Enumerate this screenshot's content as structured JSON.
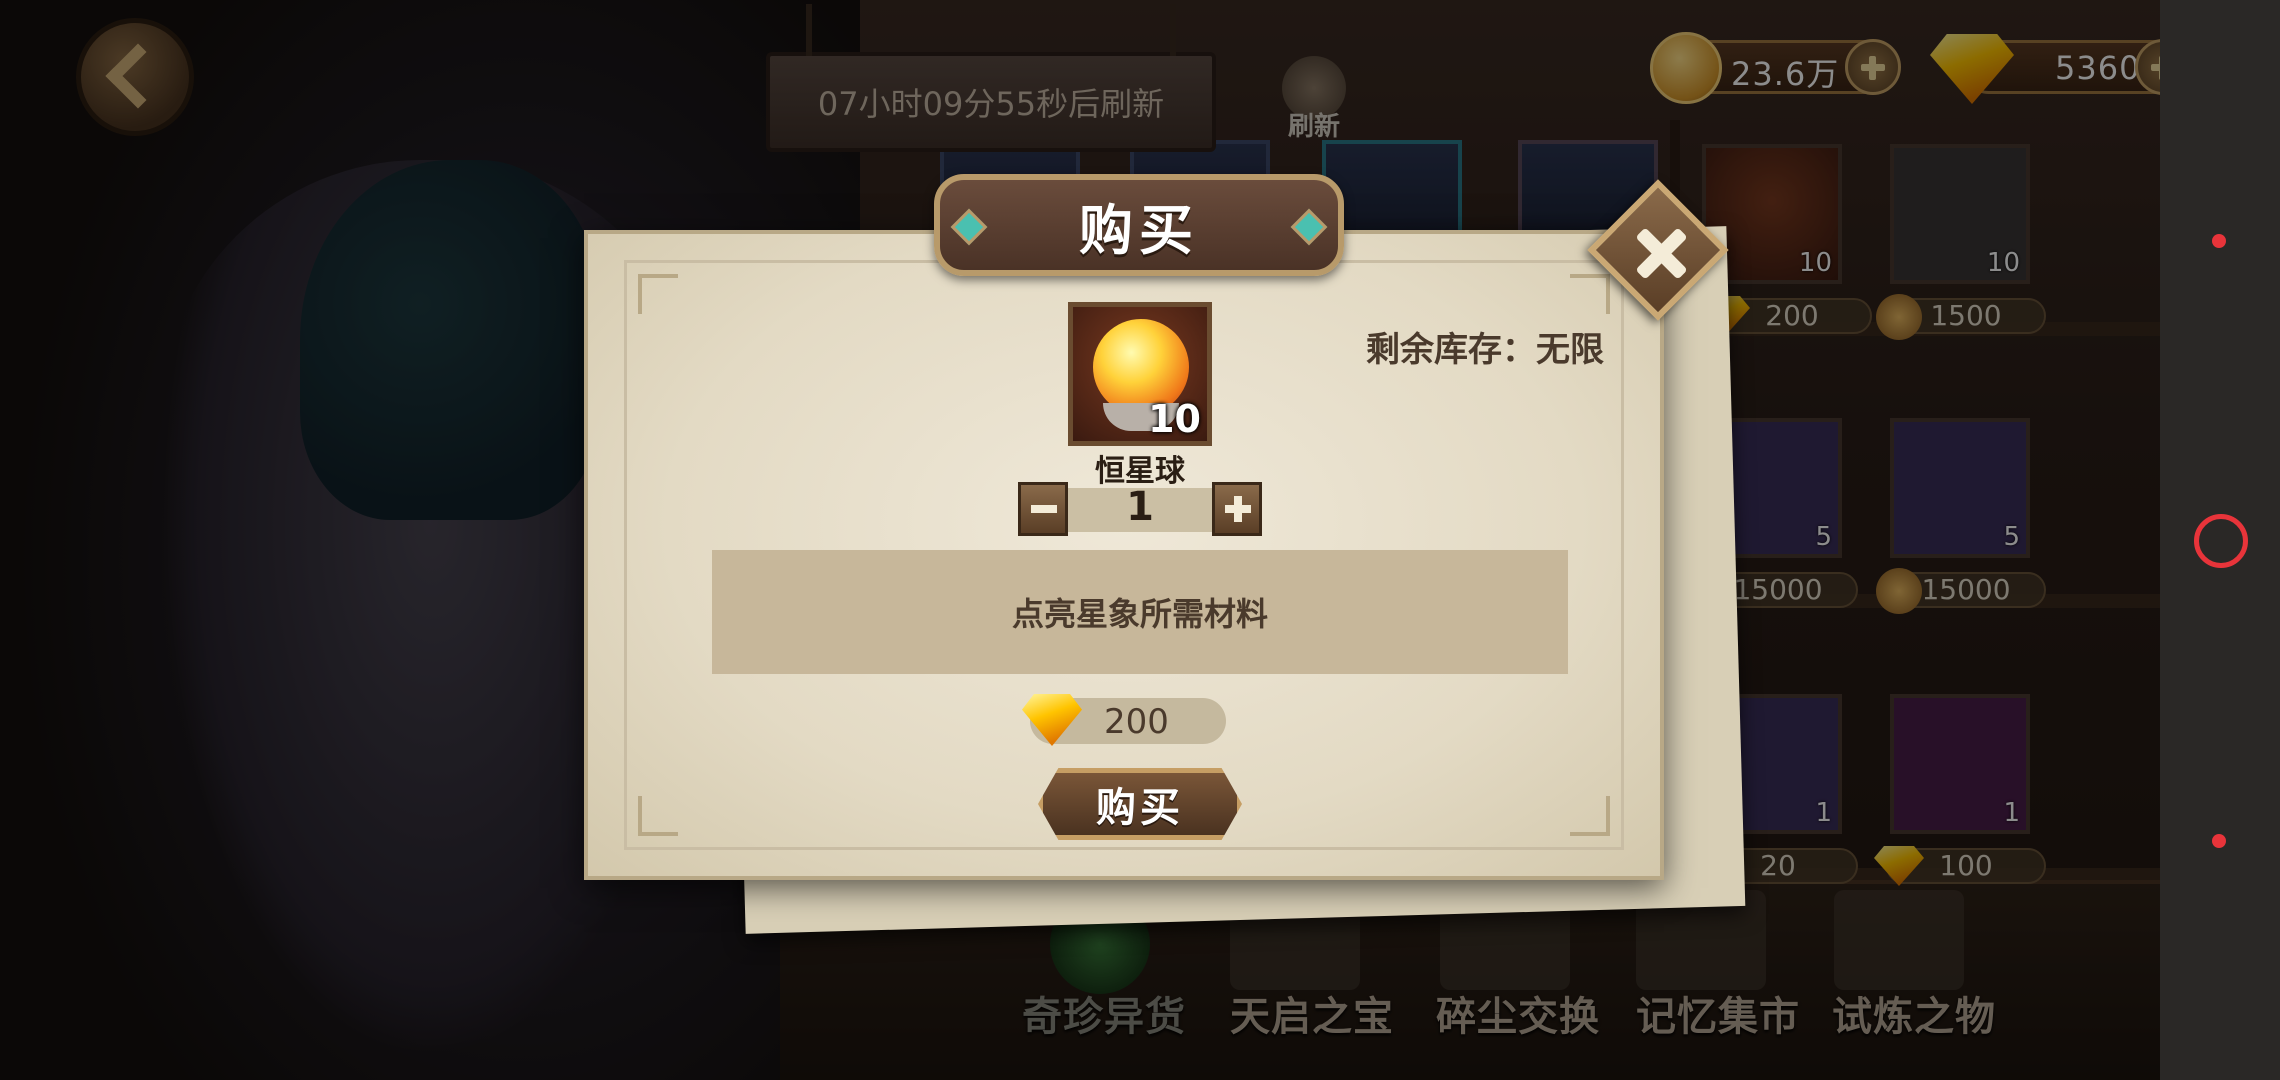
{
  "header": {
    "refresh_timer": "07小时09分55秒后刷新",
    "refresh_label": "刷新",
    "coins": "23.6万",
    "gems": "5360"
  },
  "shop_slots": [
    {
      "qty": "10",
      "price": "200",
      "currency": "gem"
    },
    {
      "qty": "10",
      "price": "1500",
      "currency": "coin"
    },
    {
      "qty": "5",
      "price": "15000",
      "currency": "coin"
    },
    {
      "qty": "5",
      "price": "15000",
      "currency": "coin"
    },
    {
      "qty": "1",
      "price": "20",
      "currency": "gem"
    },
    {
      "qty": "1",
      "price": "100",
      "currency": "gem"
    }
  ],
  "tabs": [
    "奇珍异货",
    "天启之宝",
    "碎尘交换",
    "记忆集市",
    "试炼之物"
  ],
  "modal": {
    "title": "购买",
    "stock": "剩余库存：无限",
    "item_name": "恒星球",
    "item_qty": "10",
    "quantity": "1",
    "description": "点亮星象所需材料",
    "cost": "200",
    "buy_label": "购买"
  },
  "colors": {
    "gem": "#ffc400",
    "modal_bg": "#e3dac4",
    "accent_red": "#e8343a"
  }
}
